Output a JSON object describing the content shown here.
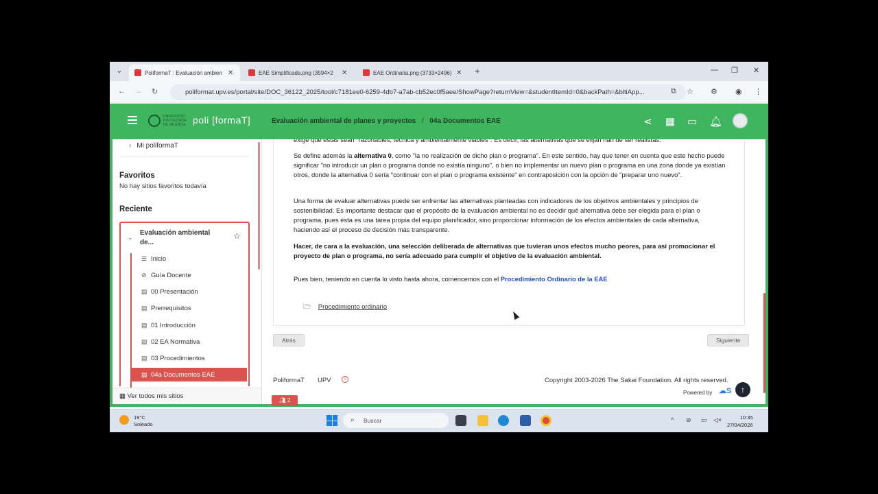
{
  "browser": {
    "tabs": [
      {
        "title": "PoliformaT : Evaluación ambien"
      },
      {
        "title": "EAE Simplificada.png (3594×2"
      },
      {
        "title": "EAE Ordinaria.png (3733×2496)"
      }
    ],
    "url": "poliformat.upv.es/portal/site/DOC_36122_2025/tool/c7181ee0-6259-4db7-a7ab-cb52ec0f5aee/ShowPage?returnView=&studentItemId=0&backPath=&bltiApp..."
  },
  "header": {
    "logo_text": "poli [formaT]",
    "logo_upv": "UNIVERSITAT POLITÈCNICA DE VALÈNCIA",
    "breadcrumb": [
      "Evaluación ambiental de planes y proyectos",
      "04a Documentos EAE"
    ],
    "breadcrumb_sep": "/"
  },
  "sidebar": {
    "mi_poliformat": "Mi poliformaT",
    "favoritos_heading": "Favoritos",
    "favoritos_empty": "No hay sitios favoritos todavía",
    "reciente_heading": "Reciente",
    "site_title": "Evaluación ambiental de...",
    "tools": [
      {
        "label": "Inicio",
        "icon": "list-icon"
      },
      {
        "label": "Guía Docente",
        "icon": "compass-icon"
      },
      {
        "label": "00 Presentación",
        "icon": "page-icon"
      },
      {
        "label": "Prerrequisitos",
        "icon": "page-icon"
      },
      {
        "label": "01 Introducción",
        "icon": "page-icon"
      },
      {
        "label": "02 EA Normativa",
        "icon": "page-icon"
      },
      {
        "label": "03 Procedimientos",
        "icon": "page-icon"
      },
      {
        "label": "04a Documentos EAE",
        "icon": "page-icon",
        "selected": true
      }
    ],
    "footer": "Ver todos mis sitios"
  },
  "content": {
    "p0": "exige que éstas sean \"razonables, técnica y ambientalmente viables\". Es decir, las alternativas que se elijan han de ser realistas.",
    "p1_pre": "Se define además la ",
    "p1_bold": "alternativa 0",
    "p1_post": ", como \"la no realización de dicho plan o programa\". En este sentido, hay que tener en cuenta que este hecho puede significar \"no introducir un plan o programa donde no existía ninguno\", o bien no implementar un nuevo plan o programa en una zona donde ya existían otros, donde la alternativa 0 sería \"continuar con el plan o programa existente\" en contraposición con la opción de \"preparar uno nuevo\".",
    "p2": "Una forma de evaluar alternativas puede ser enfrentar las alternativas planteadas con indicadores de los objetivos ambientales y principios de sostenibilidad. Es importante destacar que el propósito de la evaluación ambiental no es decidir qué alternativa debe ser elegida para el plan o programa, pues ésta es una tarea propia del equipo planificador, sino proporcionar información de los efectos ambientales de cada alternativa, haciendo así el proceso de decisión más transparente.",
    "p3": "Hacer, de cara a la evaluación, una selección deliberada de alternativas que tuvieran unos efectos mucho peores, para así promocionar el proyecto de plan o programa, no sería adecuado para cumplir el objetivo de la evaluación ambiental.",
    "p4_pre": "Pues bien, teniendo en cuenta lo visto hasta ahora, comencemos con el ",
    "p4_link": "Procedimiento Ordinario de la EAE",
    "item_link": "Procedimiento ordinario",
    "back_btn": "Atrás",
    "next_btn": "Siguiente"
  },
  "footer": {
    "link1": "PoliformaT",
    "link2": "UPV",
    "copyright": "Copyright 2003-2026 The Sakai Foundation. All rights reserved.",
    "powered": "Powered by",
    "presence_count": "2"
  },
  "taskbar": {
    "temp": "19°C",
    "weather": "Soleado",
    "search_placeholder": "Buscar",
    "time": "10:35",
    "date": "27/04/2026"
  },
  "colors": {
    "green": "#3fb55f",
    "red": "#d9534f",
    "link": "#1f4fd1"
  }
}
